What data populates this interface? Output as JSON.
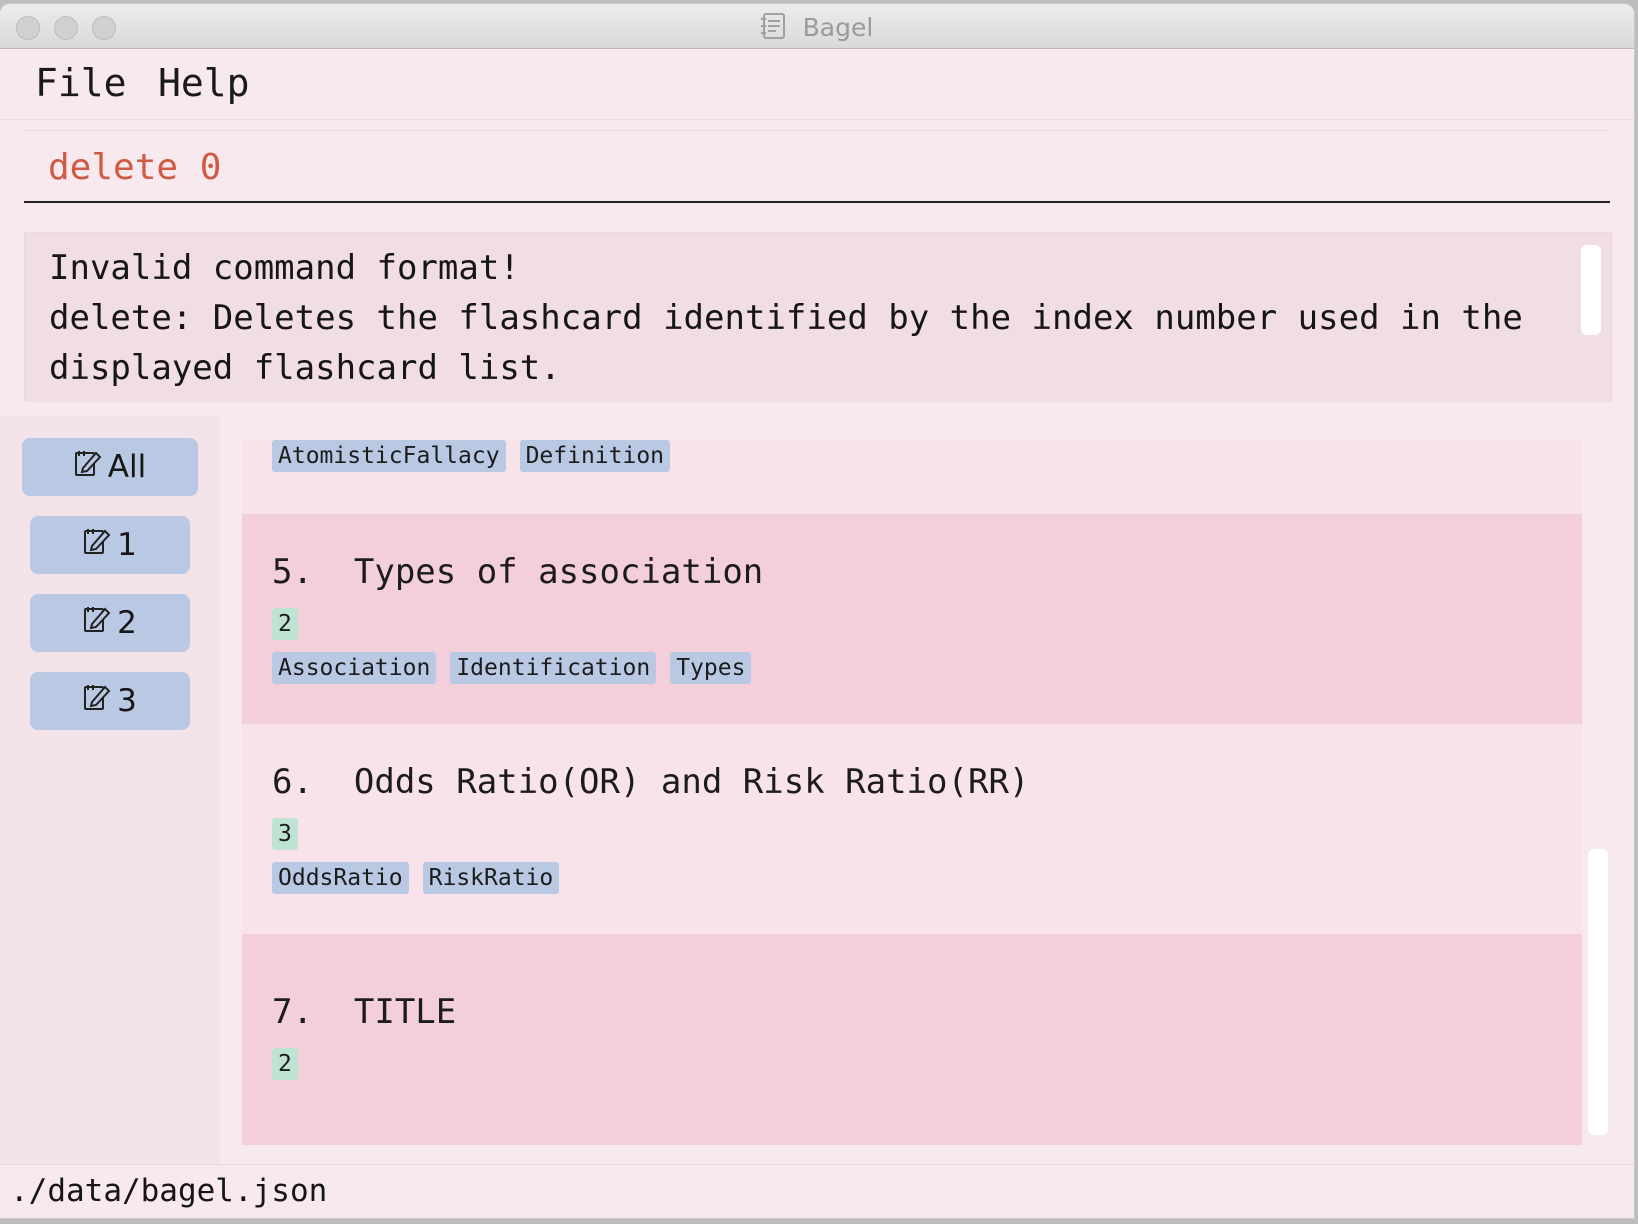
{
  "window": {
    "title": "Bagel",
    "app_icon": "notebook-icon"
  },
  "menu": {
    "file": "File",
    "help": "Help"
  },
  "command": {
    "value": "delete 0",
    "text_color": "#d05a43"
  },
  "result": {
    "text": "Invalid command format!\ndelete: Deletes the flashcard identified by the index number used in the\ndisplayed flashcard list."
  },
  "sidebar": {
    "items": [
      {
        "label": "All",
        "icon": "edit-note-icon"
      },
      {
        "label": "1",
        "icon": "edit-note-icon"
      },
      {
        "label": "2",
        "icon": "edit-note-icon"
      },
      {
        "label": "3",
        "icon": "edit-note-icon"
      }
    ]
  },
  "flashcards": [
    {
      "title": "",
      "set": "",
      "tags": [
        "AtomisticFallacy",
        "Definition"
      ]
    },
    {
      "title": "5.  Types of association",
      "set": "2",
      "tags": [
        "Association",
        "Identification",
        "Types"
      ]
    },
    {
      "title": "6.  Odds Ratio(OR) and Risk Ratio(RR)",
      "set": "3",
      "tags": [
        "OddsRatio",
        "RiskRatio"
      ]
    },
    {
      "title": "7.  TITLE",
      "set": "2",
      "tags": []
    }
  ],
  "status": {
    "file_path": "./data/bagel.json"
  },
  "colors": {
    "background": "#f8e9ef",
    "card_alt": "#f3cfdc",
    "tag_blue": "#b9c9e4",
    "badge_green": "#bfe3d2"
  }
}
